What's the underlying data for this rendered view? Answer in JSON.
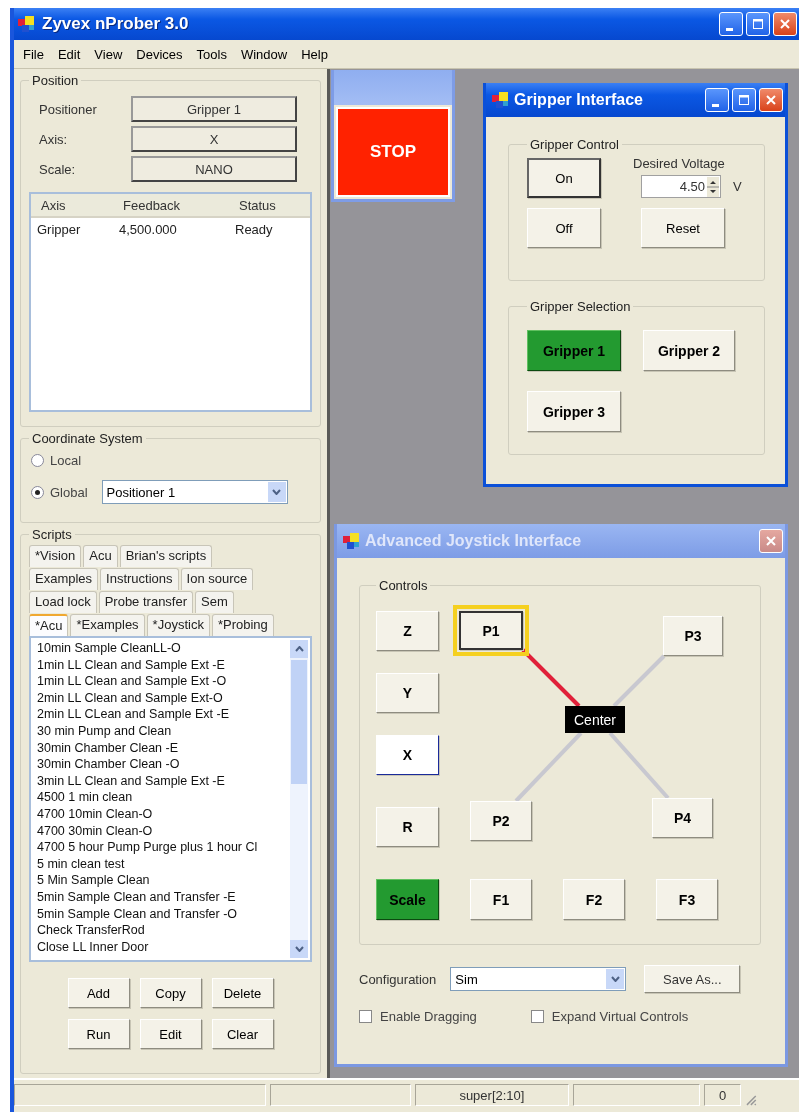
{
  "window": {
    "title": "Zyvex nProber 3.0"
  },
  "menu": [
    "File",
    "Edit",
    "View",
    "Devices",
    "Tools",
    "Window",
    "Help"
  ],
  "position": {
    "title": "Position",
    "fields": [
      {
        "label": "Positioner",
        "value": "Gripper 1"
      },
      {
        "label": "Axis:",
        "value": "X"
      },
      {
        "label": "Scale:",
        "value": "NANO"
      }
    ],
    "table": {
      "columns": [
        "Axis",
        "Feedback",
        "Status"
      ],
      "rows": [
        [
          "Gripper",
          "4,500.000",
          "Ready"
        ]
      ]
    }
  },
  "coordinate_system": {
    "title": "Coordinate System",
    "options": [
      {
        "label": "Local",
        "selected": false
      },
      {
        "label": "Global",
        "selected": true
      }
    ],
    "frame": "Positioner 1"
  },
  "scripts": {
    "title": "Scripts",
    "tab_rows": [
      [
        {
          "label": "*Vision",
          "selected": false
        },
        {
          "label": "Acu",
          "selected": false
        },
        {
          "label": "Brian's scripts",
          "selected": false
        }
      ],
      [
        {
          "label": "Examples",
          "selected": false
        },
        {
          "label": "Instructions",
          "selected": false
        },
        {
          "label": "Ion source",
          "selected": false
        }
      ],
      [
        {
          "label": "Load lock",
          "selected": false
        },
        {
          "label": "Probe transfer",
          "selected": false
        },
        {
          "label": "Sem",
          "selected": false
        }
      ],
      [
        {
          "label": "*Acu",
          "selected": true
        },
        {
          "label": "*Examples",
          "selected": false
        },
        {
          "label": "*Joystick",
          "selected": false
        },
        {
          "label": "*Probing",
          "selected": false
        }
      ]
    ],
    "items": [
      "10min Sample CleanLL-O",
      "1min LL Clean and Sample Ext -E",
      "1min LL Clean and Sample Ext -O",
      "2min LL Clean and Sample Ext-O",
      "2min LL CLean and Sample Ext -E",
      "30 min Pump and Clean",
      "30min Chamber Clean -E",
      "30min Chamber Clean -O",
      "3min LL Clean and Sample Ext -E",
      "4500 1 min clean",
      "4700 10min Clean-O",
      "4700 30min Clean-O",
      "4700 5 hour Pump Purge plus 1 hour Cl",
      "5 min clean test",
      "5 Min Sample Clean",
      "5min Sample Clean and Transfer -E",
      "5min Sample Clean and Transfer -O",
      "Check TransferRod",
      "Close LL Inner Door"
    ],
    "buttons": [
      [
        "Add",
        "Copy",
        "Delete"
      ],
      [
        "Run",
        "Edit",
        "Clear"
      ]
    ]
  },
  "stop_window": {
    "button": "STOP"
  },
  "gripper_window": {
    "title": "Gripper Interface",
    "active": true,
    "control": {
      "title": "Gripper Control",
      "buttons": [
        {
          "label": "On",
          "focused": true
        },
        {
          "label": "Off",
          "focused": false
        }
      ],
      "voltage_label": "Desired Voltage",
      "voltage": "4.50",
      "unit": "V",
      "reset": "Reset"
    },
    "selection": {
      "title": "Gripper Selection",
      "grippers": [
        {
          "label": "Gripper 1",
          "selected": true
        },
        {
          "label": "Gripper 2",
          "selected": false
        },
        {
          "label": "Gripper 3",
          "selected": false
        }
      ]
    }
  },
  "joystick_window": {
    "title": "Advanced Joystick Interface",
    "active": false,
    "controls_title": "Controls",
    "axes": [
      {
        "label": "Z",
        "selected": false
      },
      {
        "label": "Y",
        "selected": false
      },
      {
        "label": "X",
        "selected": true
      },
      {
        "label": "R",
        "selected": false
      }
    ],
    "scale": {
      "label": "Scale",
      "on": true
    },
    "points": [
      {
        "label": "P1",
        "selected": true
      },
      {
        "label": "P3",
        "selected": false
      },
      {
        "label": "P2",
        "selected": false
      },
      {
        "label": "P4",
        "selected": false
      }
    ],
    "center": "Center",
    "functions": [
      "F1",
      "F2",
      "F3"
    ],
    "configuration": {
      "label": "Configuration",
      "value": "Sim",
      "button": "Save As..."
    },
    "options": [
      {
        "label": "Enable Dragging",
        "checked": false
      },
      {
        "label": "Expand Virtual Controls",
        "checked": false
      }
    ]
  },
  "status_bar": {
    "user": "super[2:10]",
    "count": "0"
  }
}
